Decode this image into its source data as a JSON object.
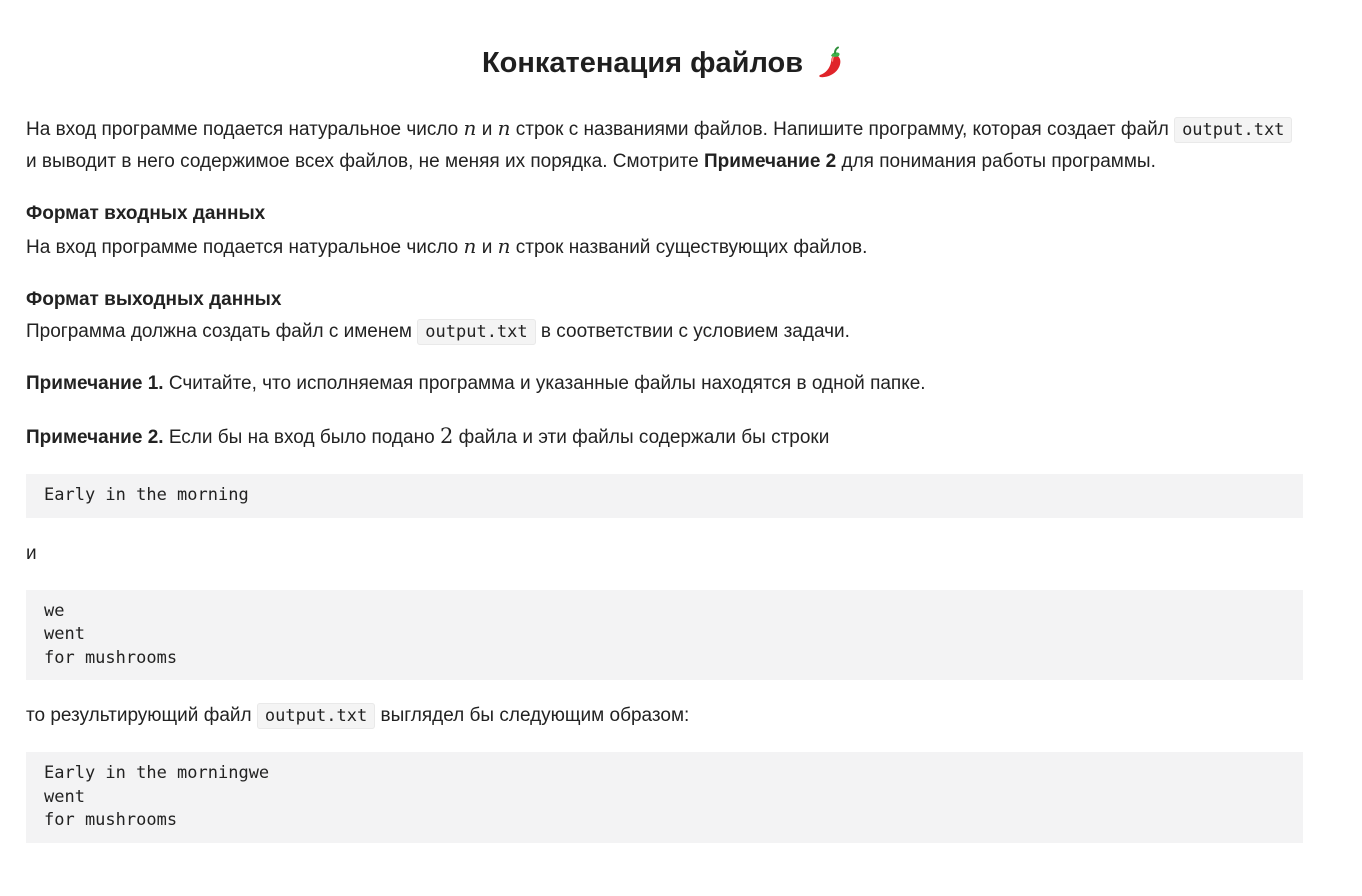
{
  "title": "Конкатенация файлов",
  "title_icon": "chili-pepper-icon",
  "colors": {
    "text": "#222222",
    "code_bg": "#f3f3f4",
    "chili_red": "#e0242a",
    "chili_green": "#3cb24a"
  },
  "intro": {
    "part1": "На вход программе подается натуральное число ",
    "var_n1": "n",
    "part2": " и ",
    "var_n2": "n",
    "part3": " строк с названиями файлов. Напишите программу, которая создает файл ",
    "code": "output.txt",
    "part4": " и выводит в него содержимое всех файлов, не меняя их порядка. Смотрите ",
    "bold": "Примечание 2",
    "part5": " для понимания работы программы."
  },
  "input_format": {
    "heading": "Формат входных данных",
    "part1": "На вход программе подается натуральное число ",
    "var_n1": "n",
    "part2": " и ",
    "var_n2": "n",
    "part3": " строк названий существующих файлов."
  },
  "output_format": {
    "heading": "Формат выходных данных",
    "part1": "Программа должна создать файл с именем ",
    "code": "output.txt",
    "part2": " в соответствии с условием задачи."
  },
  "note1": {
    "label": "Примечание 1.",
    "text": " Считайте, что исполняемая программа и указанные файлы находятся в одной папке."
  },
  "note2": {
    "label": "Примечание 2.",
    "part1": " Если бы на вход было подано ",
    "num": "2",
    "part2": " файла и эти файлы содержали бы строки"
  },
  "file1_content": "Early in the morning",
  "and_word": "и",
  "file2_content": "we\nwent\nfor mushrooms",
  "result_sentence": {
    "part1": "то результирующий файл ",
    "code": "output.txt",
    "part2": " выглядел бы следующим образом:"
  },
  "result_content": "Early in the morningwe\nwent\nfor mushrooms"
}
